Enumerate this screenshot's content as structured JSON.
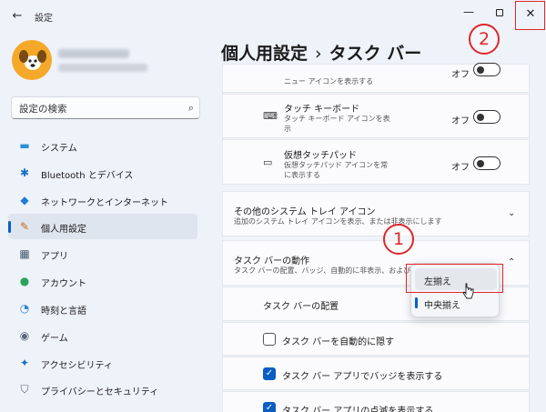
{
  "window": {
    "title": "設定",
    "back_icon": "←",
    "minimize_icon": "—",
    "close_icon": "✕"
  },
  "search": {
    "placeholder": "設定の検索",
    "icon": "⌕"
  },
  "sidebar": {
    "items": [
      {
        "label": "システム",
        "icon": "monitor-icon",
        "glyph": "▬",
        "color": "#2b8fd6",
        "active": false
      },
      {
        "label": "Bluetooth とデバイス",
        "icon": "bluetooth-icon",
        "glyph": "✱",
        "color": "#1a6fc9",
        "active": false
      },
      {
        "label": "ネットワークとインターネット",
        "icon": "wifi-icon",
        "glyph": "◆",
        "color": "#1e7ad6",
        "active": false
      },
      {
        "label": "個人用設定",
        "icon": "brush-icon",
        "glyph": "✎",
        "color": "#c56b1e",
        "active": true
      },
      {
        "label": "アプリ",
        "icon": "apps-icon",
        "glyph": "▦",
        "color": "#46586e",
        "active": false
      },
      {
        "label": "アカウント",
        "icon": "account-icon",
        "glyph": "●",
        "color": "#2aa35a",
        "active": false
      },
      {
        "label": "時刻と言語",
        "icon": "clock-globe-icon",
        "glyph": "◔",
        "color": "#2b7fcf",
        "active": false
      },
      {
        "label": "ゲーム",
        "icon": "gamepad-icon",
        "glyph": "◉",
        "color": "#5f6b78",
        "active": false
      },
      {
        "label": "アクセシビリティ",
        "icon": "accessibility-icon",
        "glyph": "✦",
        "color": "#1a6fc9",
        "active": false
      },
      {
        "label": "プライバシーとセキュリティ",
        "icon": "shield-icon",
        "glyph": "⛉",
        "color": "#5a6470",
        "active": false
      }
    ]
  },
  "header": {
    "parent": "個人用設定",
    "separator": "›",
    "current": "タスク バー"
  },
  "annotations": {
    "one": "1",
    "two": "2"
  },
  "content": {
    "partial_row": {
      "sub": "ニュー アイコンを表示する",
      "toggle": "オフ"
    },
    "touch_keyboard": {
      "title": "タッチ キーボード",
      "sub1": "タッチ キーボード アイコンを表",
      "sub2": "示",
      "toggle": "オフ",
      "icon": "keyboard-icon"
    },
    "touchpad": {
      "title": "仮想タッチパッド",
      "sub1": "仮想タッチパッド アイコンを常",
      "sub2": "に表示する",
      "toggle": "オフ",
      "icon": "touchpad-icon"
    },
    "tray_icons": {
      "title": "その他のシステム トレイ アイコン",
      "sub": "追加のシステム トレイ アイコンを表示、または非表示にします"
    },
    "behaviors": {
      "title": "タスク バーの動作",
      "sub": "タスク バーの配置、バッジ、自動的に非表示、および複数",
      "alignment_label": "タスク バーの配置",
      "options": [
        {
          "label": "自動的に隠す",
          "text": "タスク バーを自動的に隠す",
          "checked": false
        },
        {
          "label": "バッジ",
          "text": "タスク バー アプリでバッジを表示する",
          "checked": true
        },
        {
          "label": "点滅",
          "text": "タスク バー アプリの点滅を表示する",
          "checked": true
        }
      ]
    }
  },
  "dropdown": {
    "options": [
      "左揃え",
      "中央揃え"
    ],
    "hovered": "左揃え",
    "selected": "中央揃え"
  },
  "colors": {
    "accent": "#0a5dc2",
    "annotation_red": "#e0262a"
  }
}
